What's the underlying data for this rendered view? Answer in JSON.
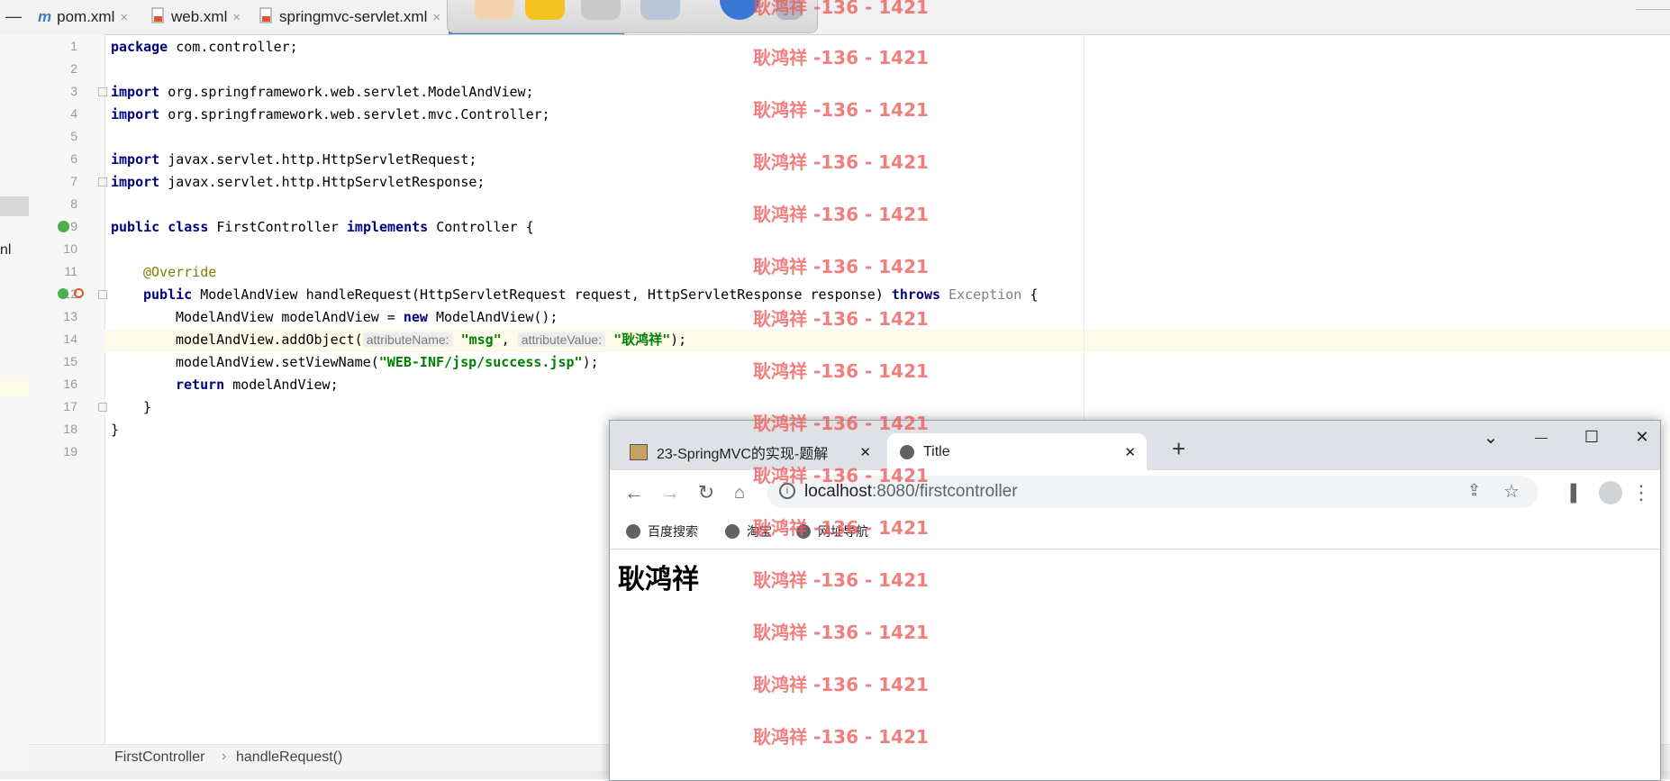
{
  "ide": {
    "tabs": [
      {
        "icon": "m",
        "label": "pom.xml"
      },
      {
        "icon": "xml-file",
        "label": "web.xml"
      },
      {
        "icon": "xml-file",
        "label": "springmvc-servlet.xml"
      }
    ],
    "tab_close": "×",
    "left_strip_partial_text": "nl",
    "line_numbers": [
      "1",
      "2",
      "3",
      "4",
      "5",
      "6",
      "7",
      "8",
      "9",
      "10",
      "11",
      "12",
      "13",
      "14",
      "15",
      "16",
      "17",
      "18",
      "19"
    ],
    "code": {
      "l1": {
        "kw": "package",
        "rest": " com.controller;"
      },
      "l3": {
        "kw": "import",
        "rest": " org.springframework.web.servlet.ModelAndView;"
      },
      "l4": {
        "kw": "import",
        "rest": " org.springframework.web.servlet.mvc.Controller;"
      },
      "l6": {
        "kw": "import",
        "rest": " javax.servlet.http.HttpServletRequest;"
      },
      "l7": {
        "kw": "import",
        "rest": " javax.servlet.http.HttpServletResponse;"
      },
      "l9": {
        "kw1": "public class",
        "name": " FirstController ",
        "kw2": "implements",
        "rest": " Controller {"
      },
      "l11": {
        "ann": "@Override"
      },
      "l12": {
        "kw": "public",
        "mid": " ModelAndView handleRequest(HttpServletRequest request, HttpServletResponse response) ",
        "kw2": "throws",
        "exc": " Exception",
        "end": " {"
      },
      "l13": {
        "pre": "ModelAndView modelAndView = ",
        "kw": "new",
        "post": " ModelAndView();"
      },
      "l14": {
        "pre": "modelAndView.addObject(",
        "hint1": "attributeName:",
        "str1": "\"msg\"",
        "comma": ", ",
        "hint2": "attributeValue:",
        "str2": "\"耿鸿祥\"",
        "post": ");"
      },
      "l15": {
        "pre": "modelAndView.setViewName(",
        "str": "\"WEB-INF/jsp/success.jsp\"",
        "post": ");"
      },
      "l16": {
        "kw": "return",
        "rest": " modelAndView;"
      },
      "l17": "}",
      "l18": "}"
    },
    "breadcrumb": [
      "FirstController",
      "handleRequest()"
    ],
    "breadcrumb_sep": "›"
  },
  "browser": {
    "tabs": [
      {
        "label": "23-SpringMVC的实现-题解"
      },
      {
        "label": "Title"
      }
    ],
    "new_tab": "+",
    "url_host": "localhost",
    "url_rest": ":8080/firstcontroller",
    "bookmarks": [
      "百度搜索",
      "淘宝",
      "网址导航"
    ],
    "page_heading": "耿鸿祥",
    "window_controls": {
      "tabsearch": "⌄",
      "minimize": "—",
      "maximize": "☐",
      "close": "✕"
    }
  },
  "watermark": {
    "text": "耿鸿祥 -136 - 1421",
    "color": "#f05a5a"
  }
}
